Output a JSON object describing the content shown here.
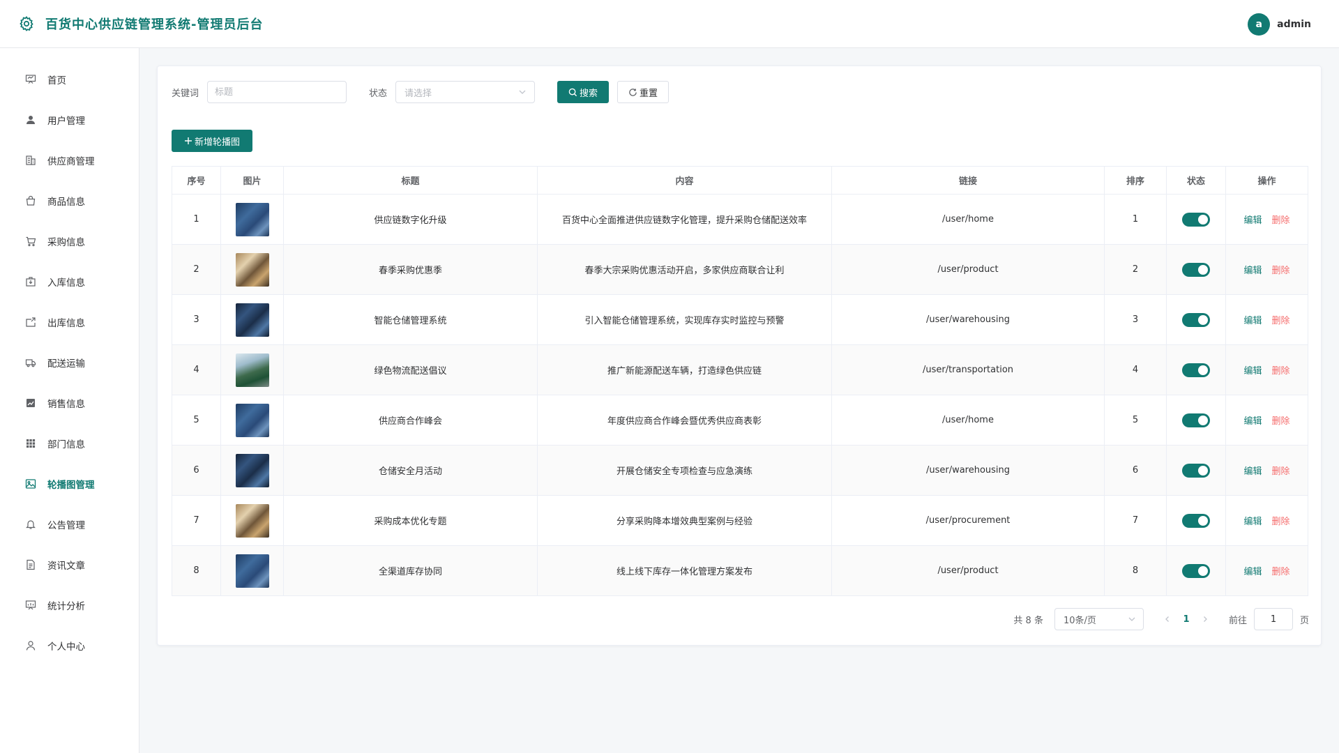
{
  "header": {
    "title": "百货中心供应链管理系统-管理员后台",
    "avatar_letter": "a",
    "username": "admin",
    "icons": {
      "logo": "gear-icon"
    }
  },
  "theme": {
    "accent": "#117a72",
    "danger": "#f56c6c"
  },
  "sidebar": {
    "items": [
      {
        "label": "首页",
        "icon": "presentation-board-icon",
        "active": false
      },
      {
        "label": "用户管理",
        "icon": "user-icon",
        "active": false
      },
      {
        "label": "供应商管理",
        "icon": "building-icon",
        "active": false
      },
      {
        "label": "商品信息",
        "icon": "shopping-bag-icon",
        "active": false
      },
      {
        "label": "采购信息",
        "icon": "shopping-cart-icon",
        "active": false
      },
      {
        "label": "入库信息",
        "icon": "box-in-icon",
        "active": false
      },
      {
        "label": "出库信息",
        "icon": "box-out-icon",
        "active": false
      },
      {
        "label": "配送运输",
        "icon": "truck-icon",
        "active": false
      },
      {
        "label": "销售信息",
        "icon": "trend-chart-icon",
        "active": false
      },
      {
        "label": "部门信息",
        "icon": "grid-icon",
        "active": false
      },
      {
        "label": "轮播图管理",
        "icon": "image-icon",
        "active": true
      },
      {
        "label": "公告管理",
        "icon": "bell-icon",
        "active": false
      },
      {
        "label": "资讯文章",
        "icon": "document-icon",
        "active": false
      },
      {
        "label": "统计分析",
        "icon": "data-board-icon",
        "active": false
      },
      {
        "label": "个人中心",
        "icon": "user-outline-icon",
        "active": false
      }
    ]
  },
  "filter": {
    "keyword_label": "关键词",
    "keyword_placeholder": "标题",
    "keyword_value": "",
    "status_label": "状态",
    "status_placeholder": "请选择",
    "search_button": "搜索",
    "reset_button": "重置"
  },
  "toolbar": {
    "add_button": "新增轮播图"
  },
  "table": {
    "columns": [
      "序号",
      "图片",
      "标题",
      "内容",
      "链接",
      "排序",
      "状态",
      "操作"
    ],
    "edit_label": "编辑",
    "delete_label": "删除",
    "rows": [
      {
        "index": "1",
        "image": "blue",
        "title": "供应链数字化升级",
        "content": "百货中心全面推进供应链数字化管理，提升采购仓储配送效率",
        "link": "/user/home",
        "sort": "1",
        "enabled": true
      },
      {
        "index": "2",
        "image": "warm",
        "title": "春季采购优惠季",
        "content": "春季大宗采购优惠活动开启，多家供应商联合让利",
        "link": "/user/product",
        "sort": "2",
        "enabled": true
      },
      {
        "index": "3",
        "image": "dark",
        "title": "智能仓储管理系统",
        "content": "引入智能仓储管理系统，实现库存实时监控与预警",
        "link": "/user/warehousing",
        "sort": "3",
        "enabled": true
      },
      {
        "index": "4",
        "image": "green",
        "title": "绿色物流配送倡议",
        "content": "推广新能源配送车辆，打造绿色供应链",
        "link": "/user/transportation",
        "sort": "4",
        "enabled": true
      },
      {
        "index": "5",
        "image": "blue",
        "title": "供应商合作峰会",
        "content": "年度供应商合作峰会暨优秀供应商表彰",
        "link": "/user/home",
        "sort": "5",
        "enabled": true
      },
      {
        "index": "6",
        "image": "dark",
        "title": "仓储安全月活动",
        "content": "开展仓储安全专项检查与应急演练",
        "link": "/user/warehousing",
        "sort": "6",
        "enabled": true
      },
      {
        "index": "7",
        "image": "warm",
        "title": "采购成本优化专题",
        "content": "分享采购降本增效典型案例与经验",
        "link": "/user/procurement",
        "sort": "7",
        "enabled": true
      },
      {
        "index": "8",
        "image": "blue",
        "title": "全渠道库存协同",
        "content": "线上线下库存一体化管理方案发布",
        "link": "/user/product",
        "sort": "8",
        "enabled": true
      }
    ]
  },
  "pagination": {
    "total_text": "共 8 条",
    "page_size": "10条/页",
    "current_page": "1",
    "goto_label": "前往",
    "goto_value": "1",
    "goto_unit": "页"
  }
}
